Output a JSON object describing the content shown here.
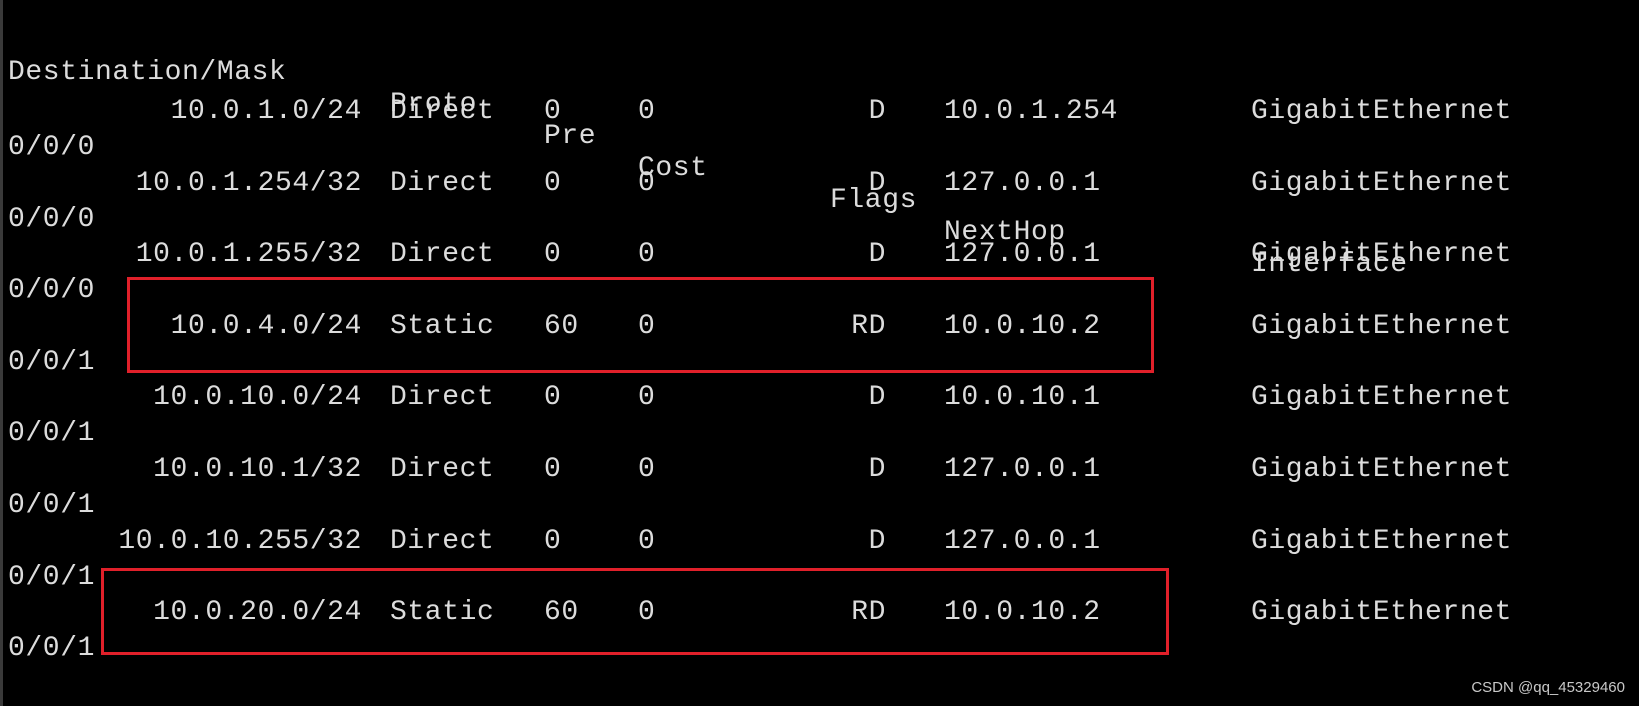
{
  "columns": {
    "destination": "Destination/Mask",
    "proto": "Proto",
    "pre": "Pre",
    "cost": "Cost",
    "flags": "Flags",
    "nexthop": "NextHop",
    "interface": "Interface"
  },
  "routes": [
    {
      "dest": "10.0.1.0/24",
      "proto": "Direct",
      "pre": "0",
      "cost": "0",
      "flags": "D",
      "nexthop": "10.0.1.254",
      "iface": "GigabitEthernet",
      "iface_cont": "0/0/0"
    },
    {
      "dest": "10.0.1.254/32",
      "proto": "Direct",
      "pre": "0",
      "cost": "0",
      "flags": "D",
      "nexthop": "127.0.0.1",
      "iface": "GigabitEthernet",
      "iface_cont": "0/0/0"
    },
    {
      "dest": "10.0.1.255/32",
      "proto": "Direct",
      "pre": "0",
      "cost": "0",
      "flags": "D",
      "nexthop": "127.0.0.1",
      "iface": "GigabitEthernet",
      "iface_cont": "0/0/0"
    },
    {
      "dest": "10.0.4.0/24",
      "proto": "Static",
      "pre": "60",
      "cost": "0",
      "flags": "RD",
      "nexthop": "10.0.10.2",
      "iface": "GigabitEthernet",
      "iface_cont": "0/0/1"
    },
    {
      "dest": "10.0.10.0/24",
      "proto": "Direct",
      "pre": "0",
      "cost": "0",
      "flags": "D",
      "nexthop": "10.0.10.1",
      "iface": "GigabitEthernet",
      "iface_cont": "0/0/1"
    },
    {
      "dest": "10.0.10.1/32",
      "proto": "Direct",
      "pre": "0",
      "cost": "0",
      "flags": "D",
      "nexthop": "127.0.0.1",
      "iface": "GigabitEthernet",
      "iface_cont": "0/0/1"
    },
    {
      "dest": "10.0.10.255/32",
      "proto": "Direct",
      "pre": "0",
      "cost": "0",
      "flags": "D",
      "nexthop": "127.0.0.1",
      "iface": "GigabitEthernet",
      "iface_cont": "0/0/1"
    },
    {
      "dest": "10.0.20.0/24",
      "proto": "Static",
      "pre": "60",
      "cost": "0",
      "flags": "RD",
      "nexthop": "10.0.10.2",
      "iface": "GigabitEthernet",
      "iface_cont": "0/0/1"
    }
  ],
  "colors": {
    "background": "#000000",
    "text": "#dcdcdc",
    "highlight_box": "#e0202a"
  },
  "watermark": "CSDN @qq_45329460"
}
